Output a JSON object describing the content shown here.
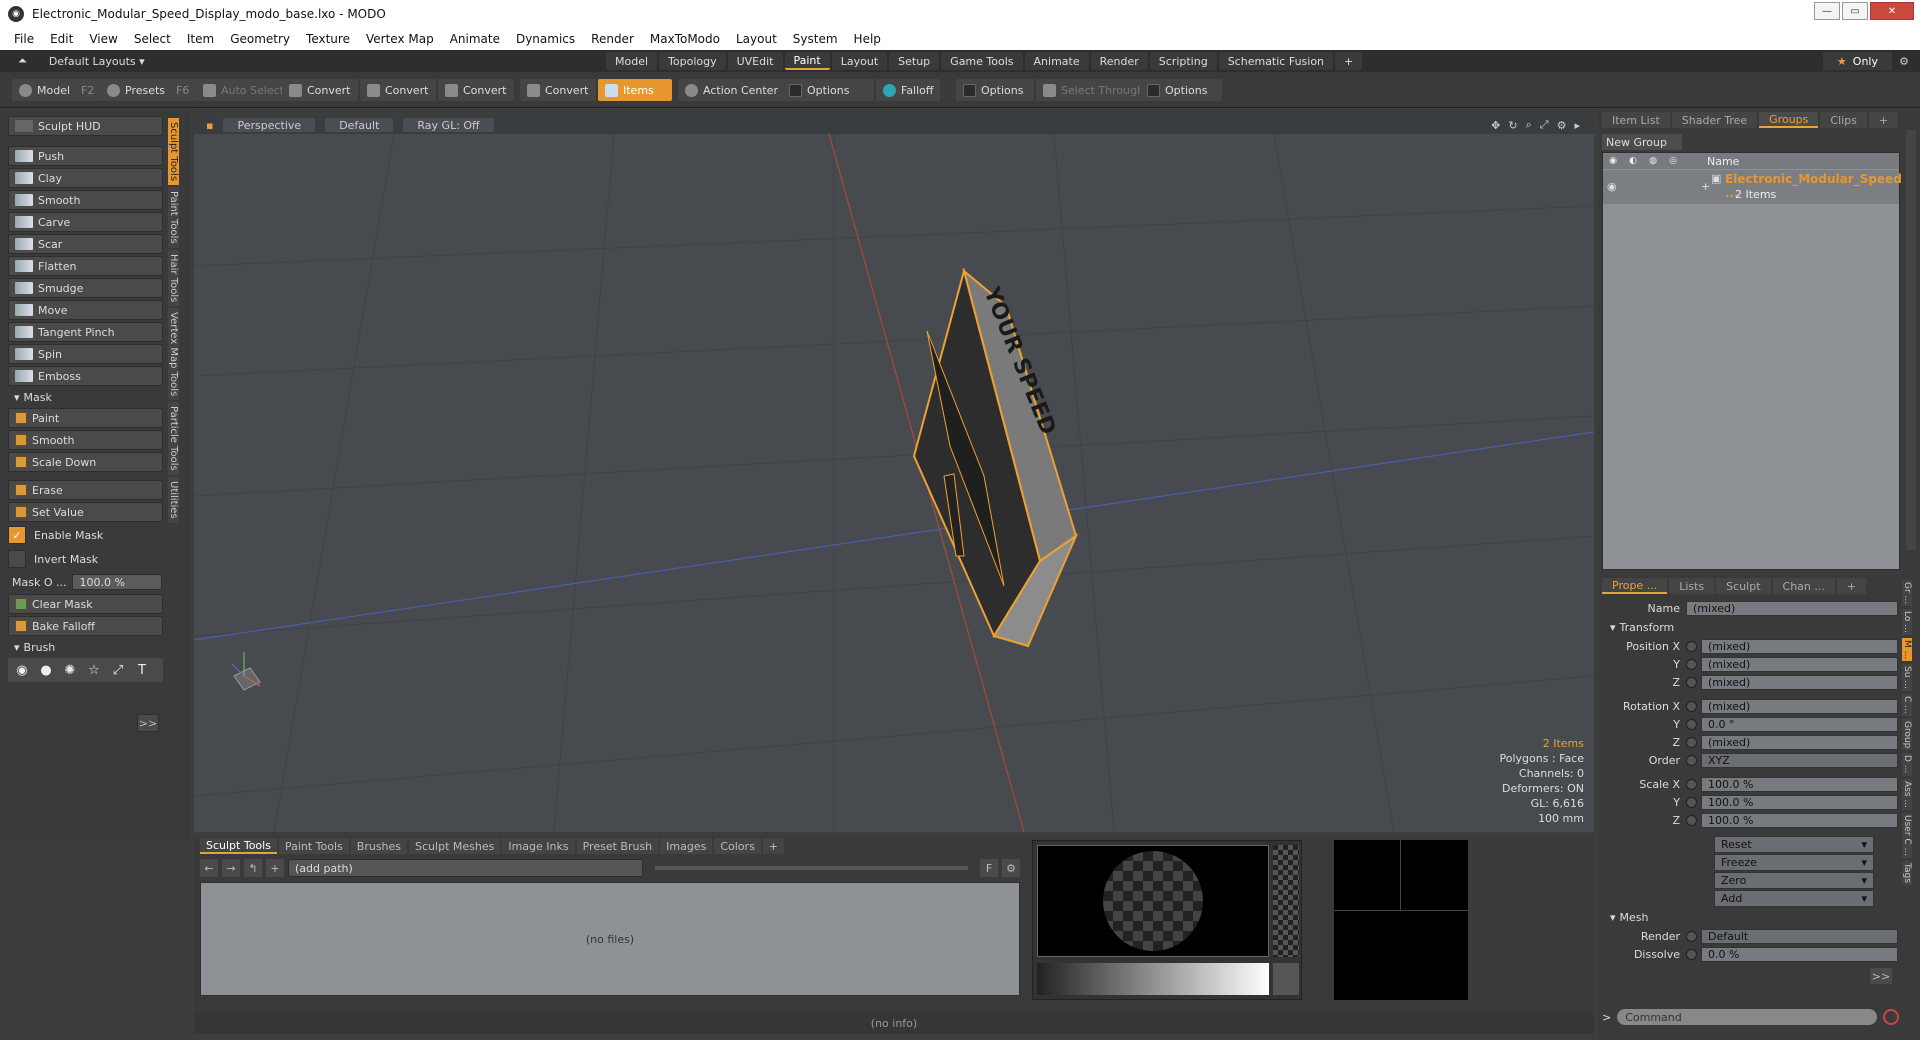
{
  "window": {
    "title": "Electronic_Modular_Speed_Display_modo_base.lxo - MODO",
    "app_icon": "modo-icon"
  },
  "menu": [
    "File",
    "Edit",
    "View",
    "Select",
    "Item",
    "Geometry",
    "Texture",
    "Vertex Map",
    "Animate",
    "Dynamics",
    "Render",
    "MaxToModo",
    "Layout",
    "System",
    "Help"
  ],
  "layouts": {
    "label": "Default Layouts ▾"
  },
  "tabs": [
    "Model",
    "Topology",
    "UVEdit",
    "Paint",
    "Layout",
    "Setup",
    "Game Tools",
    "Animate",
    "Render",
    "Scripting",
    "Schematic Fusion",
    "+"
  ],
  "active_tab": "Paint",
  "only": {
    "label": "Only"
  },
  "toolbar": {
    "model": "Model",
    "model_key": "F2",
    "presets": "Presets",
    "presets_key": "F6",
    "auto_select": "Auto Select",
    "convert1": "Convert",
    "convert2": "Convert",
    "convert3": "Convert",
    "convert4": "Convert",
    "items": "Items",
    "action_center": "Action Center",
    "options1": "Options",
    "falloff": "Falloff",
    "options2": "Options",
    "select_through": "Select Through",
    "options3": "Options"
  },
  "left": {
    "hud": "Sculpt HUD",
    "tools": [
      "Push",
      "Clay",
      "Smooth",
      "Carve",
      "Scar",
      "Flatten",
      "Smudge",
      "Move",
      "Tangent Pinch",
      "Spin",
      "Emboss"
    ],
    "mask_section": "Mask",
    "mask_tools": [
      "Paint",
      "Smooth",
      "Scale Down"
    ],
    "erase": "Erase",
    "set_value": "Set Value",
    "enable_mask": "Enable Mask",
    "invert_mask": "Invert Mask",
    "mask_opacity_label": "Mask O ...",
    "mask_opacity": "100.0 %",
    "clear_mask": "Clear Mask",
    "bake_falloff": "Bake Falloff",
    "brush_section": "Brush",
    "more": ">>",
    "vtabs": [
      "Sculpt Tools",
      "Paint Tools",
      "Hair Tools",
      "Vertex Map Tools",
      "Particle Tools",
      "Utilities"
    ]
  },
  "viewport": {
    "view": "Perspective",
    "shading": "Default",
    "raygl": "Ray GL: Off",
    "label_text": "YOUR SPEED",
    "info": {
      "items": "2 Items",
      "polygons": "Polygons : Face",
      "channels": "Channels: 0",
      "deformers": "Deformers: ON",
      "gl": "GL: 6,616",
      "scale": "100 mm"
    }
  },
  "bottom": {
    "tabs": [
      "Sculpt Tools",
      "Paint Tools",
      "Brushes",
      "Sculpt Meshes",
      "Image Inks",
      "Preset Brush",
      "Images",
      "Colors",
      "+"
    ],
    "path": "(add path)",
    "no_files": "(no files)",
    "no_info": "(no info)",
    "f_btn": "F"
  },
  "right": {
    "tabs": [
      "Item List",
      "Shader Tree",
      "Groups",
      "Clips",
      "+"
    ],
    "new_group": "New Group",
    "name_col": "Name",
    "group_name": "Electronic_Modular_Speed ...",
    "group_count": "2 Items",
    "ptabs": [
      "Prope ...",
      "Lists",
      "Sculpt",
      "Chan ...",
      "+"
    ],
    "name_label": "Name",
    "name_value": "(mixed)",
    "transform": "Transform",
    "position": [
      {
        "l": "Position X",
        "v": "(mixed)"
      },
      {
        "l": "Y",
        "v": "(mixed)"
      },
      {
        "l": "Z",
        "v": "(mixed)"
      }
    ],
    "rotation": [
      {
        "l": "Rotation X",
        "v": "(mixed)"
      },
      {
        "l": "Y",
        "v": "0.0 °"
      },
      {
        "l": "Z",
        "v": "(mixed)"
      }
    ],
    "order_label": "Order",
    "order_value": "XYZ",
    "scale": [
      {
        "l": "Scale X",
        "v": "100.0 %"
      },
      {
        "l": "Y",
        "v": "100.0 %"
      },
      {
        "l": "Z",
        "v": "100.0 %"
      }
    ],
    "actions": [
      "Reset",
      "Freeze",
      "Zero",
      "Add"
    ],
    "mesh": "Mesh",
    "render_label": "Render",
    "render_value": "Default",
    "dissolve_label": "Dissolve",
    "dissolve_value": "0.0 %",
    "more": ">>",
    "vtabs": [
      "Gr ...",
      "Lo ...",
      "M ...",
      "Su ...",
      "C ...",
      "Group",
      "D ...",
      "Ass ...",
      "User C ...",
      "Tags"
    ],
    "command_placeholder": "Command"
  },
  "colors": {
    "accent": "#e8972e",
    "viewport_bg": "#474b4f",
    "panel": "#3a3a3a"
  }
}
